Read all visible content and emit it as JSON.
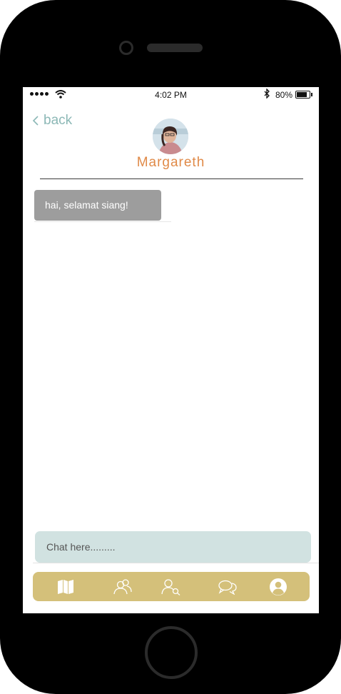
{
  "status_bar": {
    "time": "4:02 PM",
    "battery_percent": "80%",
    "signal_icon": "signal-dots-icon",
    "wifi_icon": "wifi-icon",
    "bluetooth_icon": "bluetooth-icon",
    "battery_level": 0.8
  },
  "header": {
    "back_label": "back",
    "contact_name": "Margareth"
  },
  "messages": [
    {
      "text": "hai, selamat siang!",
      "direction": "incoming"
    }
  ],
  "composer": {
    "placeholder": "Chat here........."
  },
  "tabs": [
    {
      "icon": "map-icon"
    },
    {
      "icon": "group-icon"
    },
    {
      "icon": "search-user-icon"
    },
    {
      "icon": "chat-bubbles-icon"
    },
    {
      "icon": "profile-icon"
    }
  ],
  "colors": {
    "accent_teal": "#8cb8b6",
    "name_orange": "#e08a48",
    "tabbar_gold": "#d4c07a",
    "input_bg": "#d1e2e1",
    "bubble_gray": "#9d9d9d"
  }
}
